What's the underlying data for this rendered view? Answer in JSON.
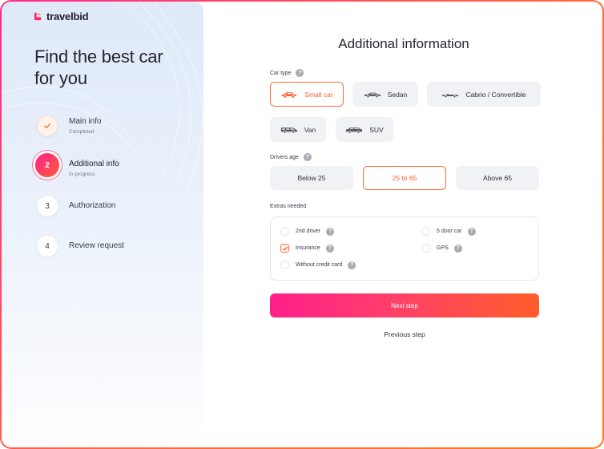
{
  "brand": {
    "name": "travelbid"
  },
  "sidebar": {
    "headline": "Find the best car for you",
    "steps": [
      {
        "number": "",
        "title": "Main info",
        "status": "Completed"
      },
      {
        "number": "2",
        "title": "Additional info",
        "status": "In progress"
      },
      {
        "number": "3",
        "title": "Authorization",
        "status": ""
      },
      {
        "number": "4",
        "title": "Review request",
        "status": ""
      }
    ]
  },
  "main": {
    "title": "Additional information",
    "car_type": {
      "label": "Car type",
      "options": [
        "Small car",
        "Sedan",
        "Cabrio / Convertible",
        "Van",
        "SUV"
      ],
      "selected": "Small car"
    },
    "drivers_age": {
      "label": "Drivers age",
      "options": [
        "Below 25",
        "25 to 65",
        "Above 65"
      ],
      "selected": "25 to 65"
    },
    "extras": {
      "label": "Extras needed",
      "items": [
        {
          "label": "2nd driver",
          "checked": false
        },
        {
          "label": "5 door car",
          "checked": false
        },
        {
          "label": "Insurance",
          "checked": true
        },
        {
          "label": "GPS",
          "checked": false
        },
        {
          "label": "Without credit card",
          "checked": false
        }
      ]
    },
    "next_label": "Next step",
    "prev_label": "Previous step"
  },
  "help_glyph": "?",
  "colors": {
    "accent_start": "#ff1f8a",
    "accent_end": "#ff5e2a",
    "selected_border": "#ff6a3d"
  }
}
